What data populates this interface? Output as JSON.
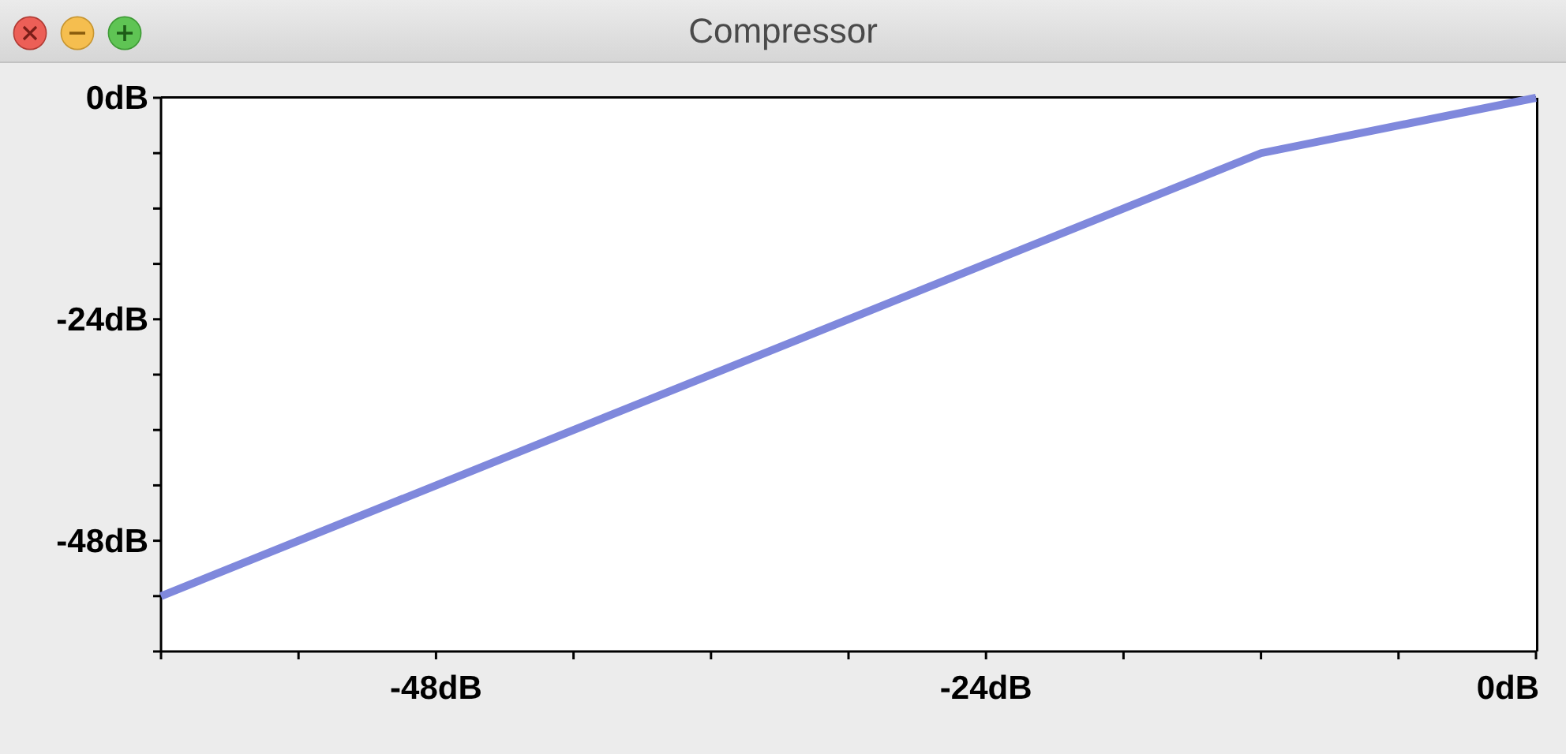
{
  "window": {
    "title": "Compressor"
  },
  "chart": {
    "chart_data": {
      "type": "line",
      "x": [
        -60,
        -12,
        0
      ],
      "series": [
        {
          "color": "#7f88dc",
          "values": [
            -54,
            -6,
            0
          ]
        }
      ],
      "xlim": [
        -60,
        0
      ],
      "ylim": [
        -60,
        0
      ],
      "xticks": [
        {
          "value": -48,
          "label": "-48dB"
        },
        {
          "value": -24,
          "label": "-24dB"
        },
        {
          "value": 0,
          "label": "0dB"
        }
      ],
      "yticks": [
        {
          "value": 0,
          "label": "0dB"
        },
        {
          "value": -24,
          "label": "-24dB"
        },
        {
          "value": -48,
          "label": "-48dB"
        }
      ]
    }
  }
}
